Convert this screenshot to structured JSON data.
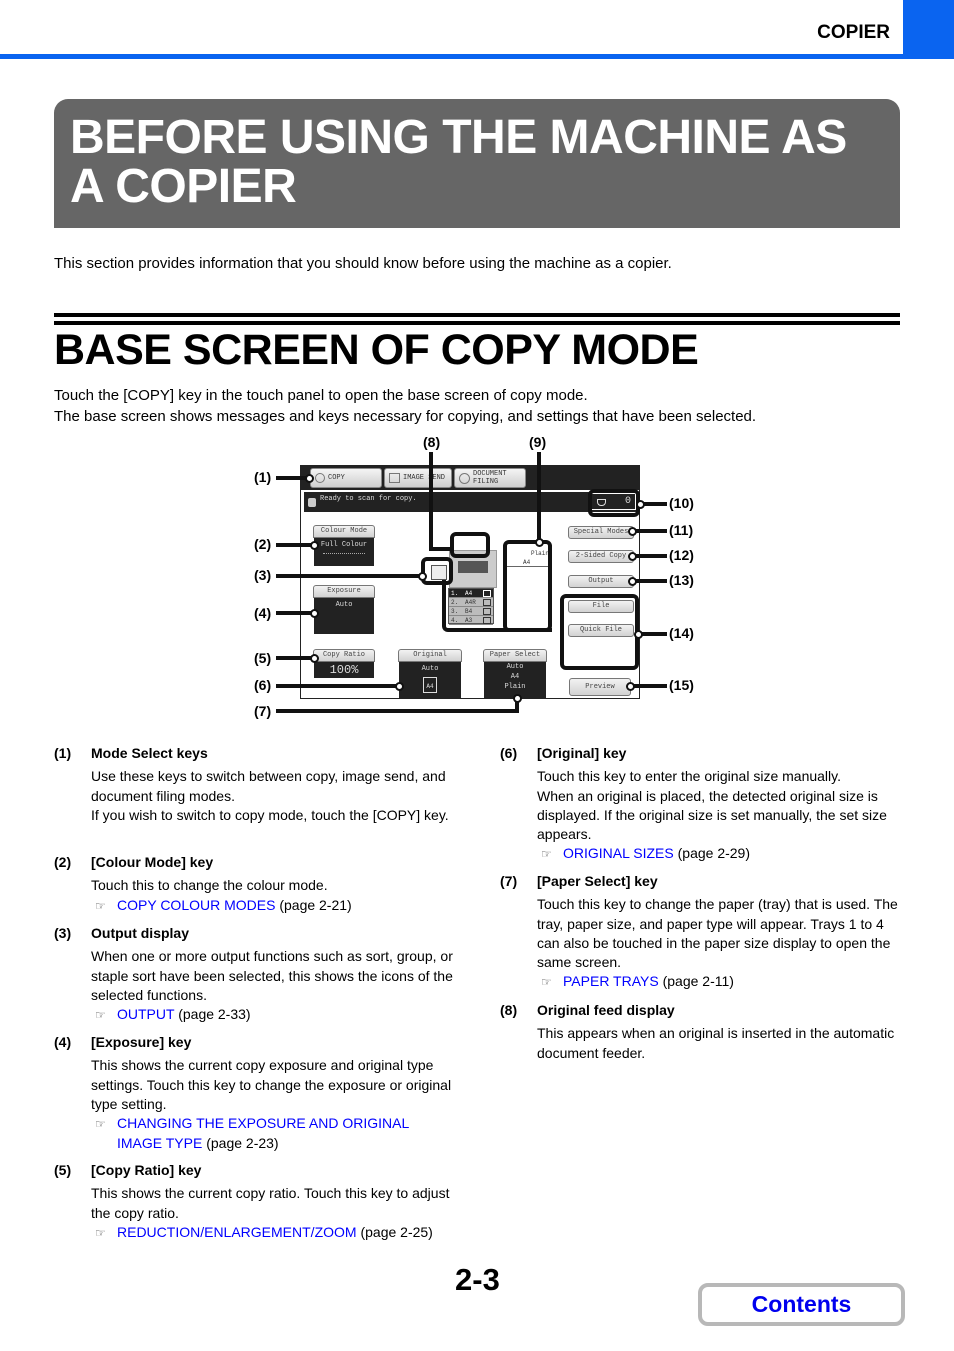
{
  "header": {
    "section_tag": "COPIER",
    "accent_color": "#0a64f0"
  },
  "chapter_title": "BEFORE USING THE MACHINE AS A COPIER",
  "chapter_intro": "This section provides information that you should know before using the machine as a copier.",
  "section": {
    "title": "BASE SCREEN OF COPY MODE",
    "para1": "Touch the [COPY] key in the touch panel to open the base screen of copy mode.",
    "para2": "The base screen shows messages and keys necessary for copying, and settings that have been selected."
  },
  "diagram": {
    "mode_keys": [
      {
        "label": "COPY",
        "icon": "copy-mode-icon"
      },
      {
        "label": "IMAGE SEND",
        "icon": "image-send-icon"
      },
      {
        "label": "DOCUMENT FILING",
        "icon": "document-filing-icon"
      }
    ],
    "message": "Ready to scan for copy.",
    "job_count": "0",
    "colour_mode": {
      "header": "Colour Mode",
      "value": "Full Colour"
    },
    "exposure": {
      "header": "Exposure",
      "value": "Auto"
    },
    "copy_ratio": {
      "header": "Copy Ratio",
      "value": "100%"
    },
    "original": {
      "header": "Original",
      "value": "Auto",
      "size": "A4"
    },
    "paper_select": {
      "header": "Paper Select",
      "value": "Auto",
      "size": "A4",
      "type": "Plain"
    },
    "paper_display": {
      "type": "Plain",
      "size": "A4"
    },
    "trays": [
      {
        "num": "1.",
        "size": "A4",
        "selected": true
      },
      {
        "num": "2.",
        "size": "A4R",
        "selected": false
      },
      {
        "num": "3.",
        "size": "B4",
        "selected": false
      },
      {
        "num": "4.",
        "size": "A3",
        "selected": false
      }
    ],
    "side_keys": {
      "special_modes": "Special Modes",
      "two_sided_copy": "2-Sided Copy",
      "output": "Output",
      "file": "File",
      "quick_file": "Quick File",
      "preview": "Preview"
    },
    "callouts": [
      "(1)",
      "(2)",
      "(3)",
      "(4)",
      "(5)",
      "(6)",
      "(7)",
      "(8)",
      "(9)",
      "(10)",
      "(11)",
      "(12)",
      "(13)",
      "(14)",
      "(15)"
    ]
  },
  "descriptions": [
    {
      "num": "(1)",
      "head": "Mode Select keys",
      "body": [
        "Use these keys to switch between copy, image send, and document filing modes.",
        "If you wish to switch to copy mode, touch the [COPY] key."
      ]
    },
    {
      "num": "(2)",
      "head": "[Colour Mode] key",
      "body": [
        "Touch this to change the colour mode."
      ],
      "ref": {
        "link": "COPY COLOUR MODES",
        "page": "(page 2-21)"
      }
    },
    {
      "num": "(3)",
      "head": "Output display",
      "body": [
        "When one or more output functions such as sort, group, or staple sort have been selected, this shows the icons of the selected functions."
      ],
      "ref": {
        "link": "OUTPUT",
        "page": "(page 2-33)"
      }
    },
    {
      "num": "(4)",
      "head": "[Exposure] key",
      "body": [
        "This shows the current copy exposure and original type settings. Touch this key to change the exposure or original type setting."
      ],
      "ref": {
        "link": "CHANGING THE EXPOSURE AND ORIGINAL IMAGE TYPE",
        "page": "(page 2-23)"
      }
    },
    {
      "num": "(5)",
      "head": "[Copy Ratio] key",
      "body": [
        "This shows the current copy ratio. Touch this key to adjust the copy ratio."
      ],
      "ref": {
        "link": "REDUCTION/ENLARGEMENT/ZOOM",
        "page": "(page 2-25)"
      }
    },
    {
      "num": "(6)",
      "head": "[Original] key",
      "body": [
        "Touch this key to enter the original size manually.",
        "When an original is placed, the detected original size is displayed. If the original size is set manually, the set size appears."
      ],
      "ref": {
        "link": "ORIGINAL SIZES",
        "page": "(page 2-29)"
      }
    },
    {
      "num": "(7)",
      "head": "[Paper Select] key",
      "body": [
        "Touch this key to change the paper (tray) that is used. The tray, paper size, and paper type will appear. Trays 1 to 4 can also be touched in the paper size display to open the same screen."
      ],
      "ref": {
        "link": "PAPER TRAYS",
        "page": "(page 2-11)"
      }
    },
    {
      "num": "(8)",
      "head": "Original feed display",
      "body": [
        "This appears when an original is inserted in the automatic document feeder."
      ]
    }
  ],
  "footer": {
    "page_number": "2-3",
    "contents_label": "Contents",
    "link_color": "#0000ff"
  }
}
